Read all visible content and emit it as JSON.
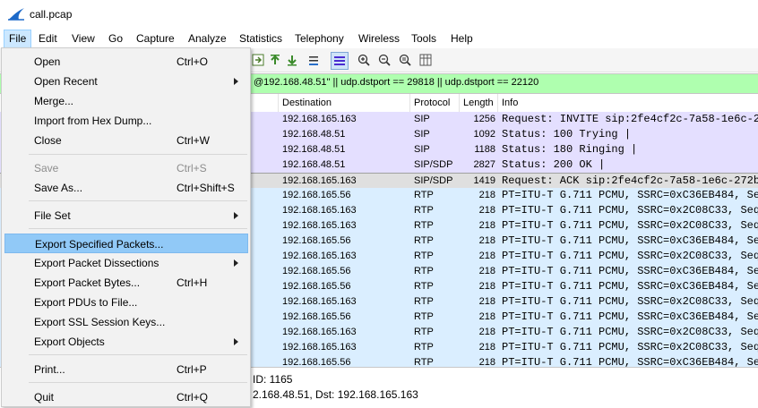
{
  "window": {
    "title": "call.pcap"
  },
  "menubar": {
    "items": [
      "File",
      "Edit",
      "View",
      "Go",
      "Capture",
      "Analyze",
      "Statistics",
      "Telephony",
      "Wireless",
      "Tools",
      "Help"
    ]
  },
  "toolbar": {
    "icons": [
      "go-to-packet-icon",
      "go-first-icon",
      "go-last-icon",
      "autoscroll-icon",
      "colorize-icon",
      "zoom-in-icon",
      "zoom-out-icon",
      "zoom-normal-icon",
      "resize-columns-icon"
    ]
  },
  "filter": {
    "text": "@192.168.48.51\" || udp.dstport == 29818 || udp.dstport == 22120"
  },
  "columns": [
    "Destination",
    "Protocol",
    "Length",
    "Info"
  ],
  "packets": [
    {
      "dest": "192.168.165.163",
      "proto": "SIP",
      "len": "1256",
      "info": "Request: INVITE sip:2fe4cf2c-7a58-1e6c-27",
      "bg": "#e4dfff"
    },
    {
      "dest": "192.168.48.51",
      "proto": "SIP",
      "len": "1092",
      "info": "Status: 100 Trying |",
      "bg": "#e4dfff"
    },
    {
      "dest": "192.168.48.51",
      "proto": "SIP",
      "len": "1188",
      "info": "Status: 180 Ringing |",
      "bg": "#e4dfff"
    },
    {
      "dest": "192.168.48.51",
      "proto": "SIP/SDP",
      "len": "2827",
      "info": "Status: 200 OK |",
      "bg": "#e4dfff"
    },
    {
      "dest": "192.168.165.163",
      "proto": "SIP/SDP",
      "len": "1419",
      "info": "Request: ACK sip:2fe4cf2c-7a58-1e6c-272b-",
      "bg": "#dfdfdf"
    },
    {
      "dest": "192.168.165.56",
      "proto": "RTP",
      "len": "218",
      "info": "PT=ITU-T G.711 PCMU, SSRC=0xC36EB484, Seq=",
      "bg": "#daeeff"
    },
    {
      "dest": "192.168.165.163",
      "proto": "RTP",
      "len": "218",
      "info": "PT=ITU-T G.711 PCMU, SSRC=0x2C08C33, Seq=",
      "bg": "#daeeff"
    },
    {
      "dest": "192.168.165.163",
      "proto": "RTP",
      "len": "218",
      "info": "PT=ITU-T G.711 PCMU, SSRC=0x2C08C33, Seq=",
      "bg": "#daeeff"
    },
    {
      "dest": "192.168.165.56",
      "proto": "RTP",
      "len": "218",
      "info": "PT=ITU-T G.711 PCMU, SSRC=0xC36EB484, Seq=",
      "bg": "#daeeff"
    },
    {
      "dest": "192.168.165.163",
      "proto": "RTP",
      "len": "218",
      "info": "PT=ITU-T G.711 PCMU, SSRC=0x2C08C33, Seq=",
      "bg": "#daeeff"
    },
    {
      "dest": "192.168.165.56",
      "proto": "RTP",
      "len": "218",
      "info": "PT=ITU-T G.711 PCMU, SSRC=0xC36EB484, Seq=",
      "bg": "#daeeff"
    },
    {
      "dest": "192.168.165.56",
      "proto": "RTP",
      "len": "218",
      "info": "PT=ITU-T G.711 PCMU, SSRC=0xC36EB484, Seq=",
      "bg": "#daeeff"
    },
    {
      "dest": "192.168.165.163",
      "proto": "RTP",
      "len": "218",
      "info": "PT=ITU-T G.711 PCMU, SSRC=0x2C08C33, Seq=",
      "bg": "#daeeff"
    },
    {
      "dest": "192.168.165.56",
      "proto": "RTP",
      "len": "218",
      "info": "PT=ITU-T G.711 PCMU, SSRC=0xC36EB484, Seq=",
      "bg": "#daeeff"
    },
    {
      "dest": "192.168.165.163",
      "proto": "RTP",
      "len": "218",
      "info": "PT=ITU-T G.711 PCMU, SSRC=0x2C08C33, Seq=",
      "bg": "#daeeff"
    },
    {
      "dest": "192.168.165.163",
      "proto": "RTP",
      "len": "218",
      "info": "PT=ITU-T G.711 PCMU, SSRC=0x2C08C33, Seq=",
      "bg": "#daeeff"
    },
    {
      "dest": "192.168.165.56",
      "proto": "RTP",
      "len": "218",
      "info": "PT=ITU-T G.711 PCMU, SSRC=0xC36EB484, Seq=",
      "bg": "#daeeff"
    }
  ],
  "detail": {
    "line1": "ID: 1165",
    "line2": "2.168.48.51, Dst: 192.168.165.163"
  },
  "file_menu": {
    "items": [
      {
        "label": "Open",
        "shortcut": "Ctrl+O"
      },
      {
        "label": "Open Recent",
        "shortcut": "",
        "submenu": true
      },
      {
        "label": "Merge...",
        "shortcut": ""
      },
      {
        "label": "Import from Hex Dump...",
        "shortcut": ""
      },
      {
        "label": "Close",
        "shortcut": "Ctrl+W"
      },
      {
        "label": "Save",
        "shortcut": "Ctrl+S",
        "disabled": true
      },
      {
        "label": "Save As...",
        "shortcut": "Ctrl+Shift+S"
      },
      {
        "label": "File Set",
        "shortcut": "",
        "submenu": true
      },
      {
        "label": "Export Specified Packets...",
        "shortcut": "",
        "highlighted": true
      },
      {
        "label": "Export Packet Dissections",
        "shortcut": "",
        "submenu": true
      },
      {
        "label": "Export Packet Bytes...",
        "shortcut": "Ctrl+H"
      },
      {
        "label": "Export PDUs to File...",
        "shortcut": ""
      },
      {
        "label": "Export SSL Session Keys...",
        "shortcut": ""
      },
      {
        "label": "Export Objects",
        "shortcut": "",
        "submenu": true
      },
      {
        "label": "Print...",
        "shortcut": "Ctrl+P"
      },
      {
        "label": "Quit",
        "shortcut": "Ctrl+Q"
      }
    ]
  },
  "colors": {
    "filter_valid": "#afffaf",
    "menu_highlight": "#91c9f7",
    "sip_row": "#e4dfff",
    "rtp_row": "#daeeff"
  }
}
